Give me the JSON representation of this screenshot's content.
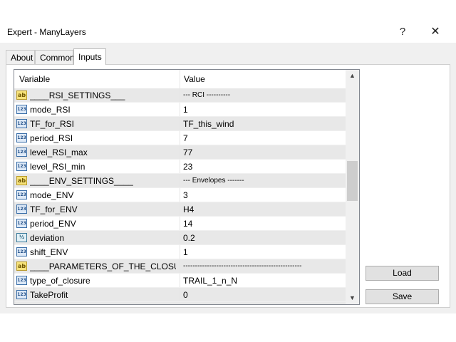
{
  "window": {
    "title": "Expert - ManyLayers",
    "help_glyph": "?",
    "close_glyph": "✕"
  },
  "tabs": [
    {
      "label": "About",
      "active": false
    },
    {
      "label": "Common",
      "active": false
    },
    {
      "label": "Inputs",
      "active": true
    }
  ],
  "grid": {
    "columns": {
      "variable": "Variable",
      "value": "Value"
    },
    "rows": [
      {
        "type": "string",
        "icon": "ab",
        "variable": "____RSI_SETTINGS___",
        "value": "--- RCI ----------"
      },
      {
        "type": "int",
        "icon": "123",
        "variable": "mode_RSI",
        "value": "1"
      },
      {
        "type": "int",
        "icon": "123",
        "variable": "TF_for_RSI",
        "value": "TF_this_wind"
      },
      {
        "type": "int",
        "icon": "123",
        "variable": "period_RSI",
        "value": "7"
      },
      {
        "type": "int",
        "icon": "123",
        "variable": "level_RSI_max",
        "value": "77"
      },
      {
        "type": "int",
        "icon": "123",
        "variable": "level_RSI_min",
        "value": "23"
      },
      {
        "type": "string",
        "icon": "ab",
        "variable": "____ENV_SETTINGS____",
        "value": "--- Envelopes -------"
      },
      {
        "type": "int",
        "icon": "123",
        "variable": "mode_ENV",
        "value": "3"
      },
      {
        "type": "int",
        "icon": "123",
        "variable": "TF_for_ENV",
        "value": "H4"
      },
      {
        "type": "int",
        "icon": "123",
        "variable": "period_ENV",
        "value": "14"
      },
      {
        "type": "double",
        "icon": "½",
        "variable": "deviation",
        "value": "0.2"
      },
      {
        "type": "int",
        "icon": "123",
        "variable": "shift_ENV",
        "value": "1"
      },
      {
        "type": "string",
        "icon": "ab",
        "variable": "____PARAMETERS_OF_THE_CLOSU...",
        "value": "--------------------------------------------------"
      },
      {
        "type": "int",
        "icon": "123",
        "variable": "type_of_closure",
        "value": "TRAIL_1_n_N"
      },
      {
        "type": "int",
        "icon": "123",
        "variable": "TakeProfit",
        "value": "0"
      }
    ]
  },
  "scrollbar": {
    "up_glyph": "▲",
    "down_glyph": "▼",
    "position_fraction": 0.48
  },
  "buttons": {
    "load": "Load",
    "save": "Save"
  }
}
